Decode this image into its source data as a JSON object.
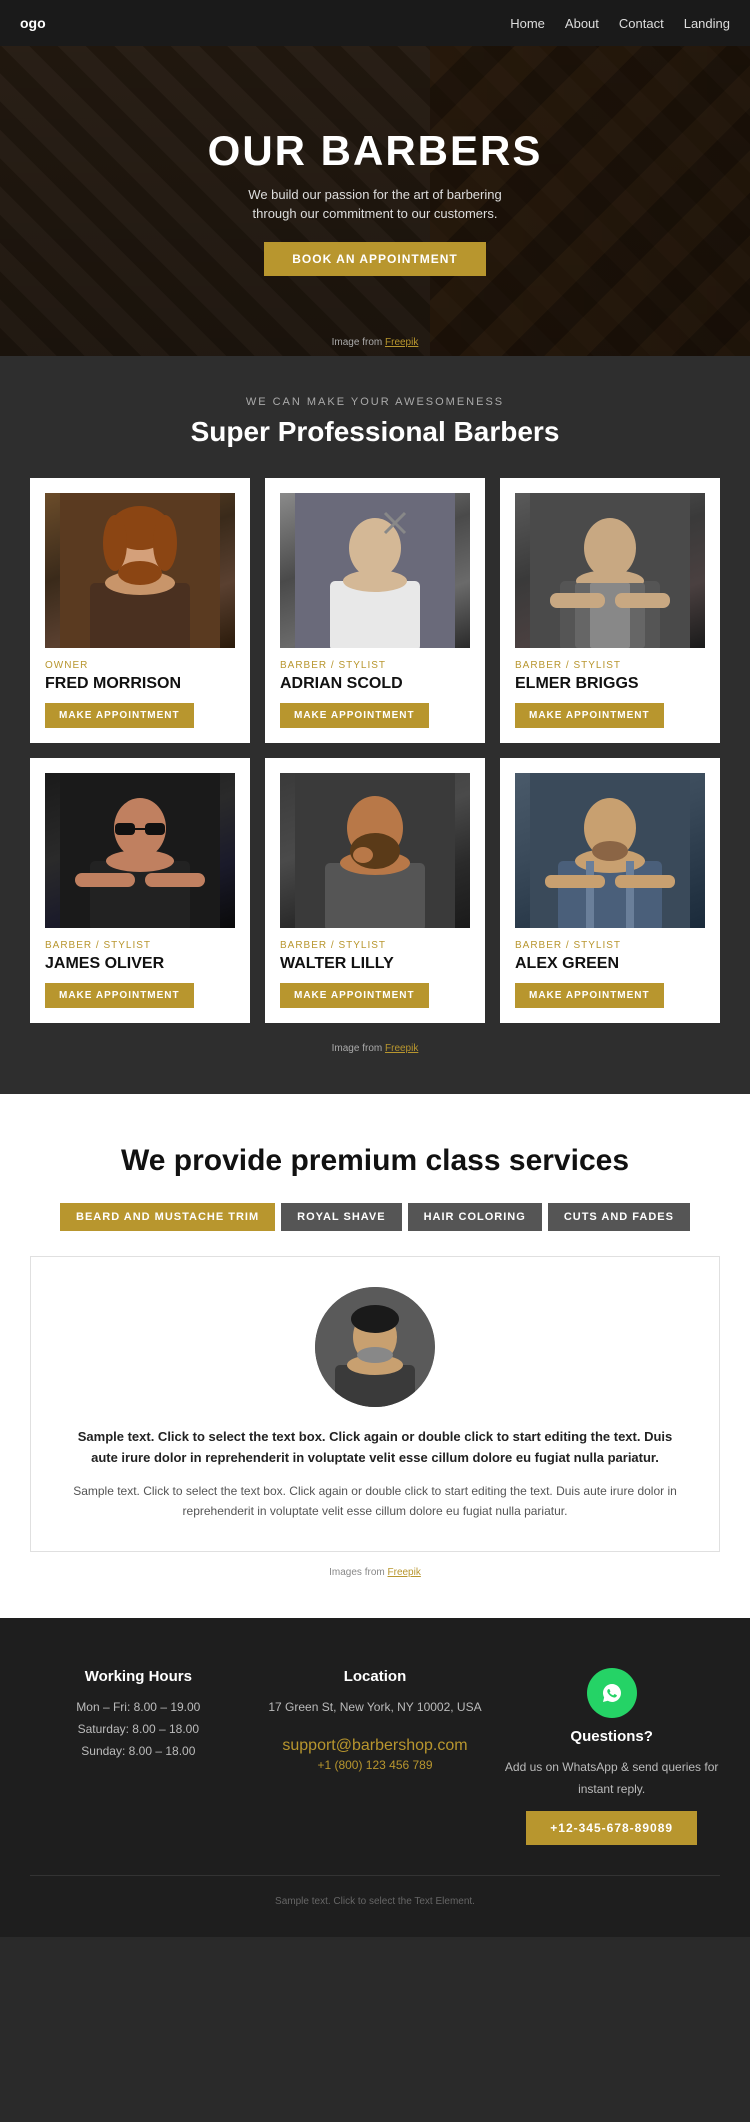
{
  "nav": {
    "logo": "ogo",
    "links": [
      {
        "label": "Home",
        "href": "#"
      },
      {
        "label": "About",
        "href": "#"
      },
      {
        "label": "Contact",
        "href": "#"
      },
      {
        "label": "Landing",
        "href": "#"
      }
    ]
  },
  "hero": {
    "title": "OUR BARBERS",
    "subtitle": "We build our passion for the art of barbering through our commitment to our customers.",
    "cta_label": "BOOK AN APPOINTMENT",
    "credit_prefix": "Image from ",
    "credit_link": "Freepik"
  },
  "barbers_section": {
    "subtitle": "WE CAN MAKE YOUR AWESOMENESS",
    "title": "Super Professional Barbers",
    "barbers": [
      {
        "role": "OWNER",
        "name": "FRED MORRISON",
        "btn": "MAKE APPOINTMENT"
      },
      {
        "role": "BARBER / STYLIST",
        "name": "ADRIAN SCOLD",
        "btn": "MAKE APPOINTMENT"
      },
      {
        "role": "BARBER / STYLIST",
        "name": "ELMER BRIGGS",
        "btn": "MAKE APPOINTMENT"
      },
      {
        "role": "BARBER / STYLIST",
        "name": "JAMES OLIVER",
        "btn": "MAKE APPOINTMENT"
      },
      {
        "role": "BARBER / STYLIST",
        "name": "WALTER LILLY",
        "btn": "MAKE APPOINTMENT"
      },
      {
        "role": "BARBER / STYLIST",
        "name": "ALEX GREEN",
        "btn": "MAKE APPOINTMENT"
      }
    ],
    "credit_prefix": "Image from ",
    "credit_link": "Freepik"
  },
  "services_section": {
    "title": "We provide premium class services",
    "tabs": [
      {
        "label": "BEARD AND MUSTACHE TRIM",
        "active": true
      },
      {
        "label": "ROYAL SHAVE",
        "active": false
      },
      {
        "label": "HAIR COLORING",
        "active": false
      },
      {
        "label": "CUTS AND FADES",
        "active": false
      }
    ],
    "service_text_bold": "Sample text. Click to select the text box. Click again or double click to start editing the text. Duis aute irure dolor in reprehenderit in voluptate velit esse cillum dolore eu fugiat nulla pariatur.",
    "service_text_normal": "Sample text. Click to select the text box. Click again or double click to start editing the text. Duis aute irure dolor in reprehenderit in voluptate velit esse cillum dolore eu fugiat nulla pariatur.",
    "credit_prefix": "Images from ",
    "credit_link": "Freepik"
  },
  "footer": {
    "col1": {
      "title": "Working Hours",
      "line1": "Mon – Fri: 8.00 – 19.00",
      "line2": "Saturday: 8.00 – 18.00",
      "line3": "Sunday: 8.00 – 18.00"
    },
    "col2": {
      "title": "Location",
      "address": "17 Green St, New York, NY 10002, USA",
      "email": "support@barbershop.com",
      "phone": "+1 (800) 123 456 789"
    },
    "col3": {
      "title": "Questions?",
      "text": "Add us on WhatsApp & send queries for instant reply.",
      "btn_label": "+12-345-678-89089"
    },
    "bottom_text": "Sample text. Click to select the Text Element."
  }
}
